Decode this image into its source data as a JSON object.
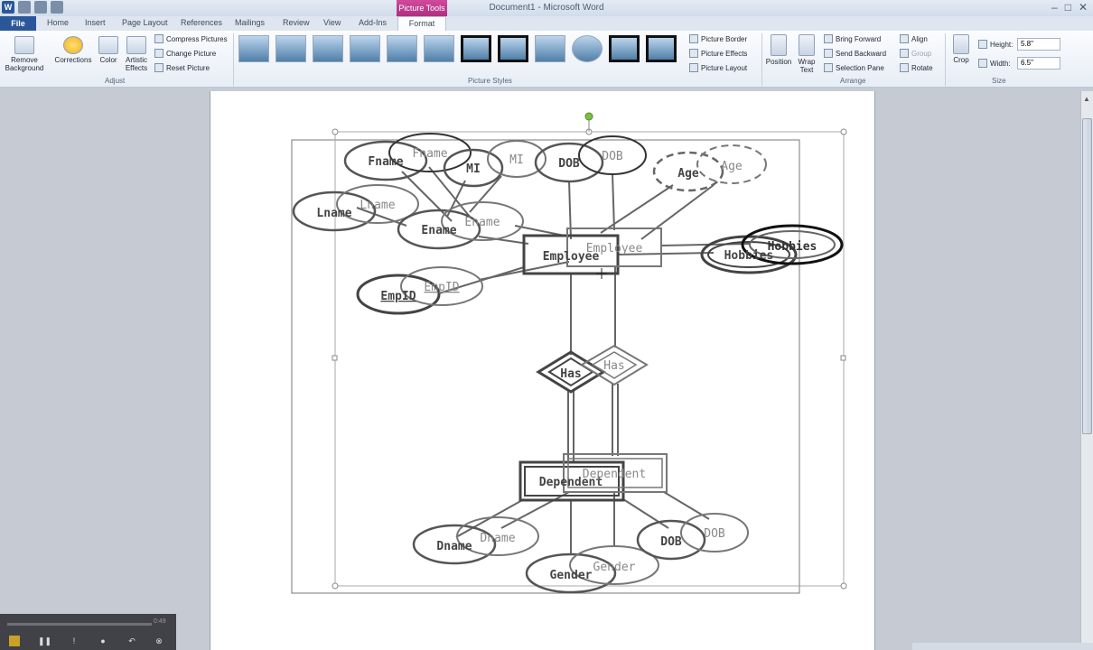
{
  "window": {
    "title": "Document1 - Microsoft Word",
    "context_tab": "Picture Tools",
    "controls": {
      "minimize": "–",
      "maximize": "□",
      "close": "✕"
    }
  },
  "tabs": {
    "file": "File",
    "items": [
      "Home",
      "Insert",
      "Page Layout",
      "References",
      "Mailings",
      "Review",
      "View",
      "Add-Ins"
    ],
    "format": "Format"
  },
  "ribbon": {
    "adjust": {
      "label": "Adjust",
      "remove_background": "Remove Background",
      "corrections": "Corrections",
      "color": "Color",
      "artistic_effects": "Artistic Effects",
      "compress": "Compress Pictures",
      "change": "Change Picture",
      "reset": "Reset Picture"
    },
    "styles": {
      "label": "Picture Styles",
      "border": "Picture Border",
      "effects": "Picture Effects",
      "layout": "Picture Layout"
    },
    "arrange": {
      "label": "Arrange",
      "position": "Position",
      "wrap_text": "Wrap Text",
      "bring_forward": "Bring Forward",
      "send_backward": "Send Backward",
      "selection_pane": "Selection Pane",
      "align": "Align",
      "group": "Group",
      "rotate": "Rotate"
    },
    "size": {
      "label": "Size",
      "crop": "Crop",
      "height_label": "Height:",
      "height_value": "5.8\"",
      "width_label": "Width:",
      "width_value": "6.5\""
    }
  },
  "diagram": {
    "entities": {
      "employee": "Employee",
      "dependent": "Dependent"
    },
    "relationship": "Has",
    "attributes": {
      "fname": "Fname",
      "mi": "MI",
      "dob": "DOB",
      "age": "Age",
      "lname": "Lname",
      "ename": "Ename",
      "hobbies": "Hobbies",
      "empid": "EmpID",
      "dname": "Dname",
      "gender": "Gender"
    }
  },
  "player": {
    "time": "0:49"
  }
}
